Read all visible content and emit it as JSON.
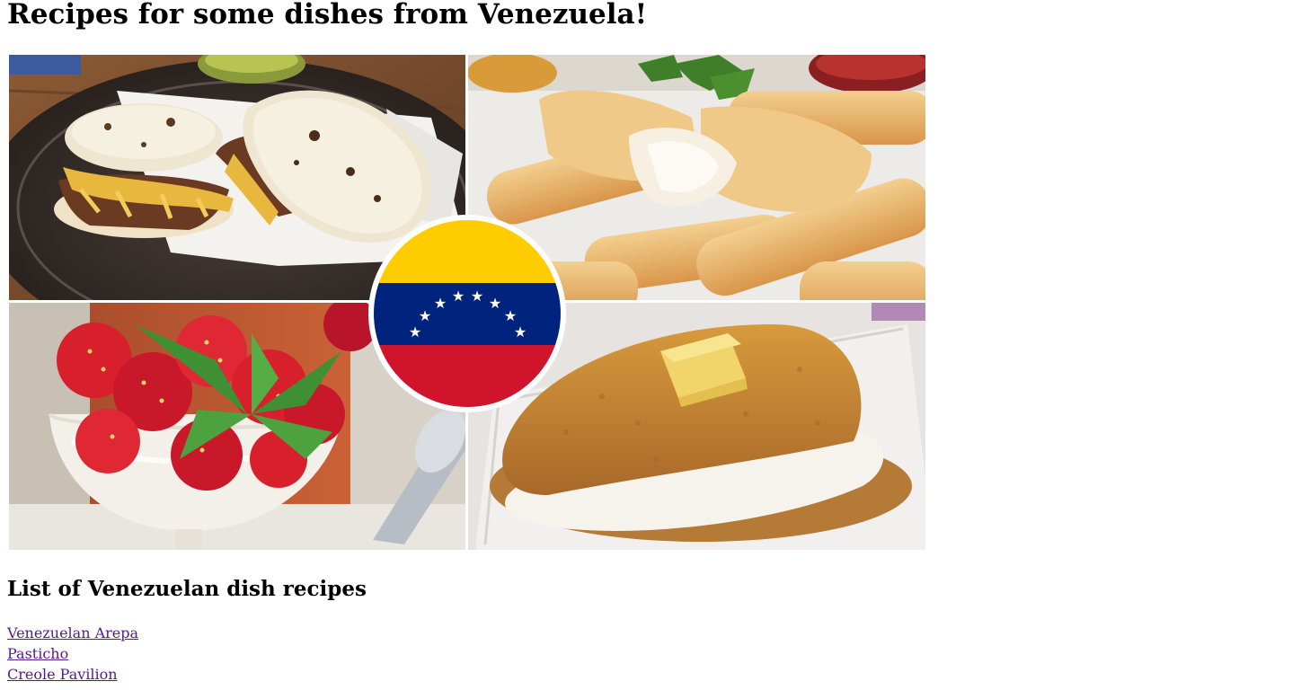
{
  "page": {
    "title": "Recipes for some dishes from Venezuela!",
    "list_heading": "List of Venezuelan dish recipes"
  },
  "collage": {
    "panels": [
      {
        "name": "arepas-photo",
        "colors": [
          "#3a2f2a",
          "#efe6d2",
          "#e8b83e",
          "#6b3a22"
        ]
      },
      {
        "name": "tequenos-photo",
        "colors": [
          "#f1f1f1",
          "#e8b36a",
          "#f7efe2",
          "#4b8f2e"
        ]
      },
      {
        "name": "strawberries-and-cream-photo",
        "colors": [
          "#c4582e",
          "#d81f2c",
          "#f3f0ea",
          "#3f8f34"
        ]
      },
      {
        "name": "cachapa-photo",
        "colors": [
          "#e7e3e0",
          "#c98a2f",
          "#f6f3ec",
          "#f1d46a"
        ]
      }
    ],
    "flag": {
      "stripes": [
        "#ffcc00",
        "#00247d",
        "#cf142b"
      ],
      "star_color": "#ffffff",
      "star_count": 8
    }
  },
  "recipes": [
    {
      "label": "Venezuelan Arepa"
    },
    {
      "label": "Pasticho"
    },
    {
      "label": "Creole Pavilion"
    }
  ],
  "colors": {
    "link_visited": "#551a8b",
    "background": "#ffffff"
  }
}
